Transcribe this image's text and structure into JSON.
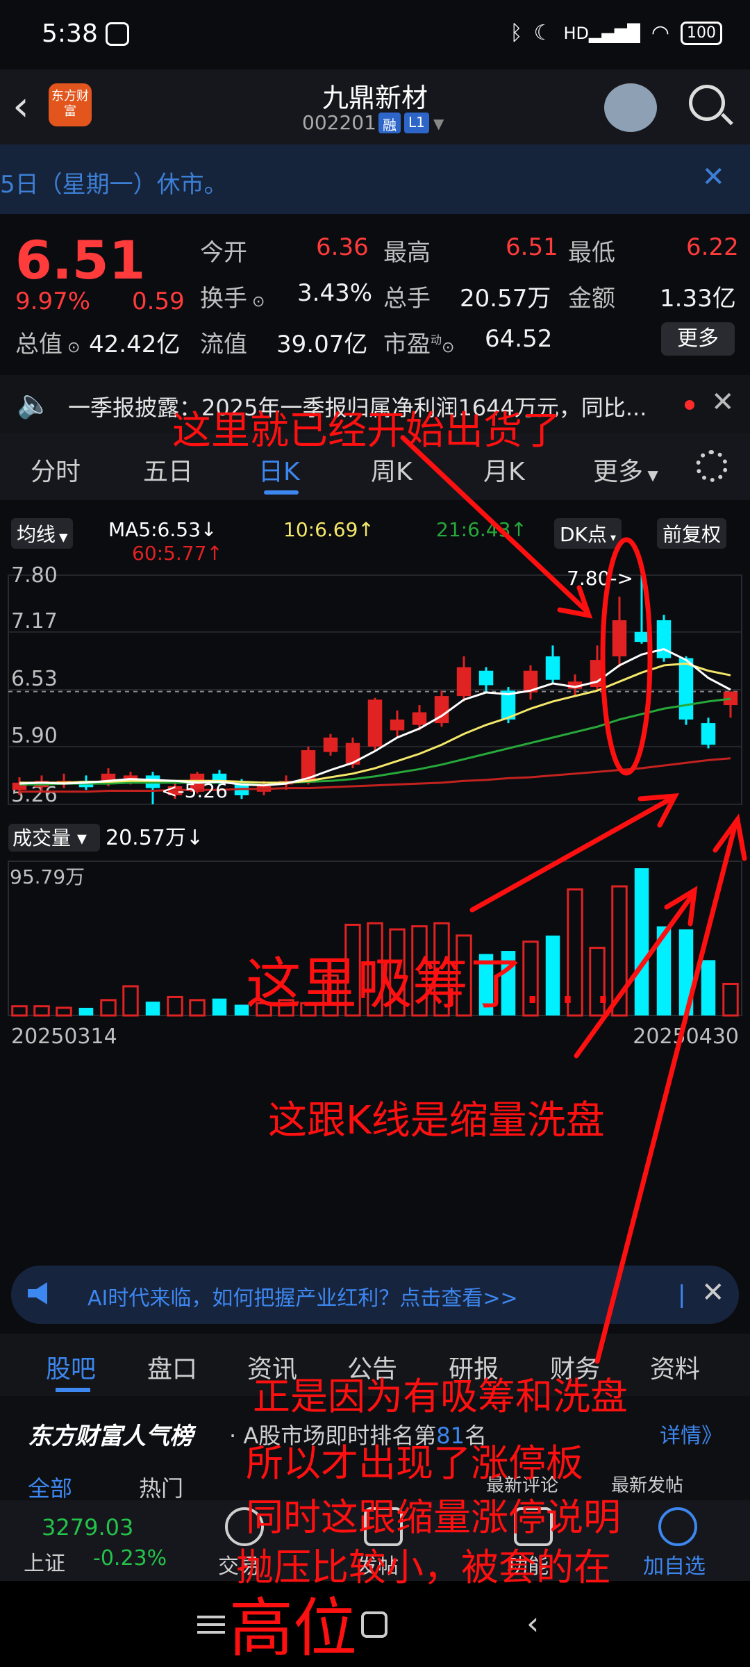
{
  "status_bar": {
    "time": "5:38",
    "icons": [
      "bluetooth-icon",
      "moon-icon",
      "signal-icon",
      "wifi-icon"
    ],
    "battery": "100",
    "hd": "HD"
  },
  "header": {
    "stock_name": "九鼎新材",
    "stock_code": "002201",
    "tag_margin": "融",
    "tag_level": "L1",
    "logo_text": "东方财富"
  },
  "notice": {
    "text": "5日（星期一）休市。"
  },
  "quote": {
    "price": "6.51",
    "change_pct": "9.97%",
    "change": "0.59",
    "open_label": "今开",
    "open": "6.36",
    "high_label": "最高",
    "high": "6.51",
    "low_label": "最低",
    "low": "6.22",
    "turnover_label": "换手",
    "turnover": "3.43%",
    "volume_label": "总手",
    "volume": "20.57万",
    "amount_label": "金额",
    "amount": "1.33亿",
    "mktcap_label": "总值",
    "mktcap": "42.42亿",
    "float_label": "流值",
    "float": "39.07亿",
    "pe_label": "市盈",
    "pe_sup": "动",
    "pe": "64.52",
    "more": "更多"
  },
  "ticker": {
    "text": "一季报披露：2025年一季报归属净利润1644万元，同比..."
  },
  "tabs": [
    "分时",
    "五日",
    "日K",
    "周K",
    "月K",
    "更多"
  ],
  "chart_header": {
    "ma_selector": "均线",
    "ma5": "MA5:6.53↓",
    "ma10": "10:6.69↑",
    "ma21": "21:6.43↑",
    "ma60": "60:5.77↑",
    "dk_button": "DK点",
    "adjust_button": "前复权"
  },
  "chart_labels": {
    "high_marker": "7.80->",
    "low_marker": "<-5.26",
    "volume_selector": "成交量",
    "volume_value": "20.57万↓",
    "volume_max": "95.79万",
    "date_start": "20250314",
    "date_end": "20250430"
  },
  "colors": {
    "up": "#e02222",
    "down": "#00f0ff",
    "ma5": "#ffffff",
    "ma10": "#f4e86a",
    "ma21": "#27a83a",
    "ma60": "#c4221e",
    "accent": "#3d87f0"
  },
  "chart_data": {
    "type": "candlestick",
    "ylim": [
      5.26,
      7.8
    ],
    "y_ticks": [
      "7.80",
      "7.17",
      "6.53",
      "5.90",
      "5.26"
    ],
    "candles": [
      {
        "o": 5.5,
        "c": 5.42,
        "h": 5.56,
        "l": 5.36,
        "dir": "up"
      },
      {
        "o": 5.45,
        "c": 5.52,
        "h": 5.58,
        "l": 5.4,
        "dir": "up"
      },
      {
        "o": 5.48,
        "c": 5.52,
        "h": 5.6,
        "l": 5.44,
        "dir": "up"
      },
      {
        "o": 5.52,
        "c": 5.45,
        "h": 5.58,
        "l": 5.42,
        "dir": "down"
      },
      {
        "o": 5.5,
        "c": 5.6,
        "h": 5.66,
        "l": 5.46,
        "dir": "up"
      },
      {
        "o": 5.52,
        "c": 5.58,
        "h": 5.62,
        "l": 5.48,
        "dir": "up"
      },
      {
        "o": 5.58,
        "c": 5.44,
        "h": 5.62,
        "l": 5.26,
        "dir": "down"
      },
      {
        "o": 5.36,
        "c": 5.46,
        "h": 5.5,
        "l": 5.32,
        "dir": "up"
      },
      {
        "o": 5.4,
        "c": 5.6,
        "h": 5.62,
        "l": 5.38,
        "dir": "up"
      },
      {
        "o": 5.6,
        "c": 5.5,
        "h": 5.64,
        "l": 5.46,
        "dir": "down"
      },
      {
        "o": 5.5,
        "c": 5.36,
        "h": 5.54,
        "l": 5.32,
        "dir": "down"
      },
      {
        "o": 5.4,
        "c": 5.46,
        "h": 5.52,
        "l": 5.36,
        "dir": "up"
      },
      {
        "o": 5.48,
        "c": 5.52,
        "h": 5.58,
        "l": 5.42,
        "dir": "up"
      },
      {
        "o": 5.5,
        "c": 5.86,
        "h": 5.9,
        "l": 5.48,
        "dir": "up"
      },
      {
        "o": 5.84,
        "c": 6.0,
        "h": 6.04,
        "l": 5.8,
        "dir": "up"
      },
      {
        "o": 5.7,
        "c": 5.94,
        "h": 6.0,
        "l": 5.66,
        "dir": "up"
      },
      {
        "o": 5.9,
        "c": 6.42,
        "h": 6.44,
        "l": 5.86,
        "dir": "up"
      },
      {
        "o": 6.08,
        "c": 6.2,
        "h": 6.3,
        "l": 6.0,
        "dir": "up"
      },
      {
        "o": 6.14,
        "c": 6.28,
        "h": 6.36,
        "l": 6.08,
        "dir": "up"
      },
      {
        "o": 6.16,
        "c": 6.46,
        "h": 6.52,
        "l": 6.12,
        "dir": "up"
      },
      {
        "o": 6.46,
        "c": 6.78,
        "h": 6.9,
        "l": 6.4,
        "dir": "up"
      },
      {
        "o": 6.74,
        "c": 6.58,
        "h": 6.78,
        "l": 6.5,
        "dir": "down"
      },
      {
        "o": 6.52,
        "c": 6.2,
        "h": 6.56,
        "l": 6.16,
        "dir": "down"
      },
      {
        "o": 6.5,
        "c": 6.74,
        "h": 6.8,
        "l": 6.42,
        "dir": "up"
      },
      {
        "o": 6.9,
        "c": 6.64,
        "h": 7.02,
        "l": 6.6,
        "dir": "down"
      },
      {
        "o": 6.54,
        "c": 6.62,
        "h": 6.7,
        "l": 6.46,
        "dir": "up"
      },
      {
        "o": 6.56,
        "c": 6.86,
        "h": 7.02,
        "l": 6.52,
        "dir": "up"
      },
      {
        "o": 6.9,
        "c": 7.3,
        "h": 7.56,
        "l": 6.78,
        "dir": "up"
      },
      {
        "o": 7.17,
        "c": 7.06,
        "h": 7.8,
        "l": 7.04,
        "dir": "down"
      },
      {
        "o": 7.3,
        "c": 6.88,
        "h": 7.36,
        "l": 6.84,
        "dir": "down"
      },
      {
        "o": 6.88,
        "c": 6.2,
        "h": 6.9,
        "l": 6.14,
        "dir": "down"
      },
      {
        "o": 6.16,
        "c": 5.92,
        "h": 6.22,
        "l": 5.88,
        "dir": "down"
      },
      {
        "o": 6.36,
        "c": 6.51,
        "h": 6.51,
        "l": 6.22,
        "dir": "up"
      }
    ],
    "ma5": [
      5.49,
      5.5,
      5.49,
      5.5,
      5.52,
      5.54,
      5.53,
      5.52,
      5.5,
      5.51,
      5.48,
      5.47,
      5.49,
      5.55,
      5.64,
      5.72,
      5.85,
      6.0,
      6.1,
      6.24,
      6.42,
      6.5,
      6.48,
      6.52,
      6.6,
      6.56,
      6.62,
      6.8,
      6.92,
      6.98,
      6.86,
      6.66,
      6.53
    ],
    "ma10": [
      5.5,
      5.5,
      5.5,
      5.51,
      5.51,
      5.52,
      5.52,
      5.52,
      5.52,
      5.52,
      5.51,
      5.5,
      5.5,
      5.52,
      5.56,
      5.6,
      5.66,
      5.74,
      5.82,
      5.92,
      6.04,
      6.14,
      6.22,
      6.32,
      6.4,
      6.46,
      6.52,
      6.62,
      6.72,
      6.8,
      6.82,
      6.74,
      6.69
    ],
    "ma21": [
      5.48,
      5.48,
      5.49,
      5.49,
      5.49,
      5.5,
      5.5,
      5.5,
      5.5,
      5.5,
      5.5,
      5.5,
      5.5,
      5.51,
      5.52,
      5.54,
      5.57,
      5.61,
      5.65,
      5.7,
      5.76,
      5.82,
      5.88,
      5.94,
      6.0,
      6.06,
      6.12,
      6.2,
      6.26,
      6.32,
      6.36,
      6.4,
      6.43
    ],
    "ma60": [
      5.4,
      5.4,
      5.4,
      5.4,
      5.41,
      5.41,
      5.41,
      5.42,
      5.42,
      5.42,
      5.43,
      5.43,
      5.44,
      5.44,
      5.45,
      5.46,
      5.47,
      5.48,
      5.49,
      5.5,
      5.52,
      5.53,
      5.55,
      5.56,
      5.58,
      5.6,
      5.62,
      5.64,
      5.66,
      5.69,
      5.72,
      5.75,
      5.77
    ],
    "volume_max": 95.79,
    "volumes": [
      6,
      6,
      5,
      5,
      10,
      19,
      9,
      12,
      10,
      11,
      7,
      8,
      10,
      8,
      26,
      59,
      60,
      56,
      58,
      60,
      52,
      40,
      42,
      48,
      52,
      82,
      44,
      84,
      95.79,
      58,
      56,
      36,
      20.57
    ],
    "x_dates": [
      "20250314",
      "20250430"
    ]
  },
  "ai_banner": {
    "text": "AI时代来临，如何把握产业红利？点击查看>>"
  },
  "bottom_tabs": [
    "股吧",
    "盘口",
    "资讯",
    "公告",
    "研报",
    "财务",
    "资料"
  ],
  "ranking": {
    "brand": "东方财富人气榜",
    "prefix": "· A股市场即时排名第",
    "rank": "81",
    "suffix": "名",
    "more": "详情》"
  },
  "filter_tabs": [
    "全部",
    "热门",
    "最新评论",
    "最新发帖"
  ],
  "index_bar": {
    "value": "3279.03",
    "name": "上证",
    "change": "-0.23%",
    "actions": [
      "交易",
      "发帖",
      "功能",
      "加自选"
    ]
  },
  "annotations": {
    "a1": "这里就已经开始出货了",
    "a2": "这里吸筹了. . .",
    "a3": "这跟K线是缩量洗盘",
    "a4": "正是因为有吸筹和洗盘",
    "a5": "所以才出现了涨停板",
    "a6": "同时这跟缩量涨停说明",
    "a7": "抛压比较小，被套的在",
    "a8": "高位"
  }
}
